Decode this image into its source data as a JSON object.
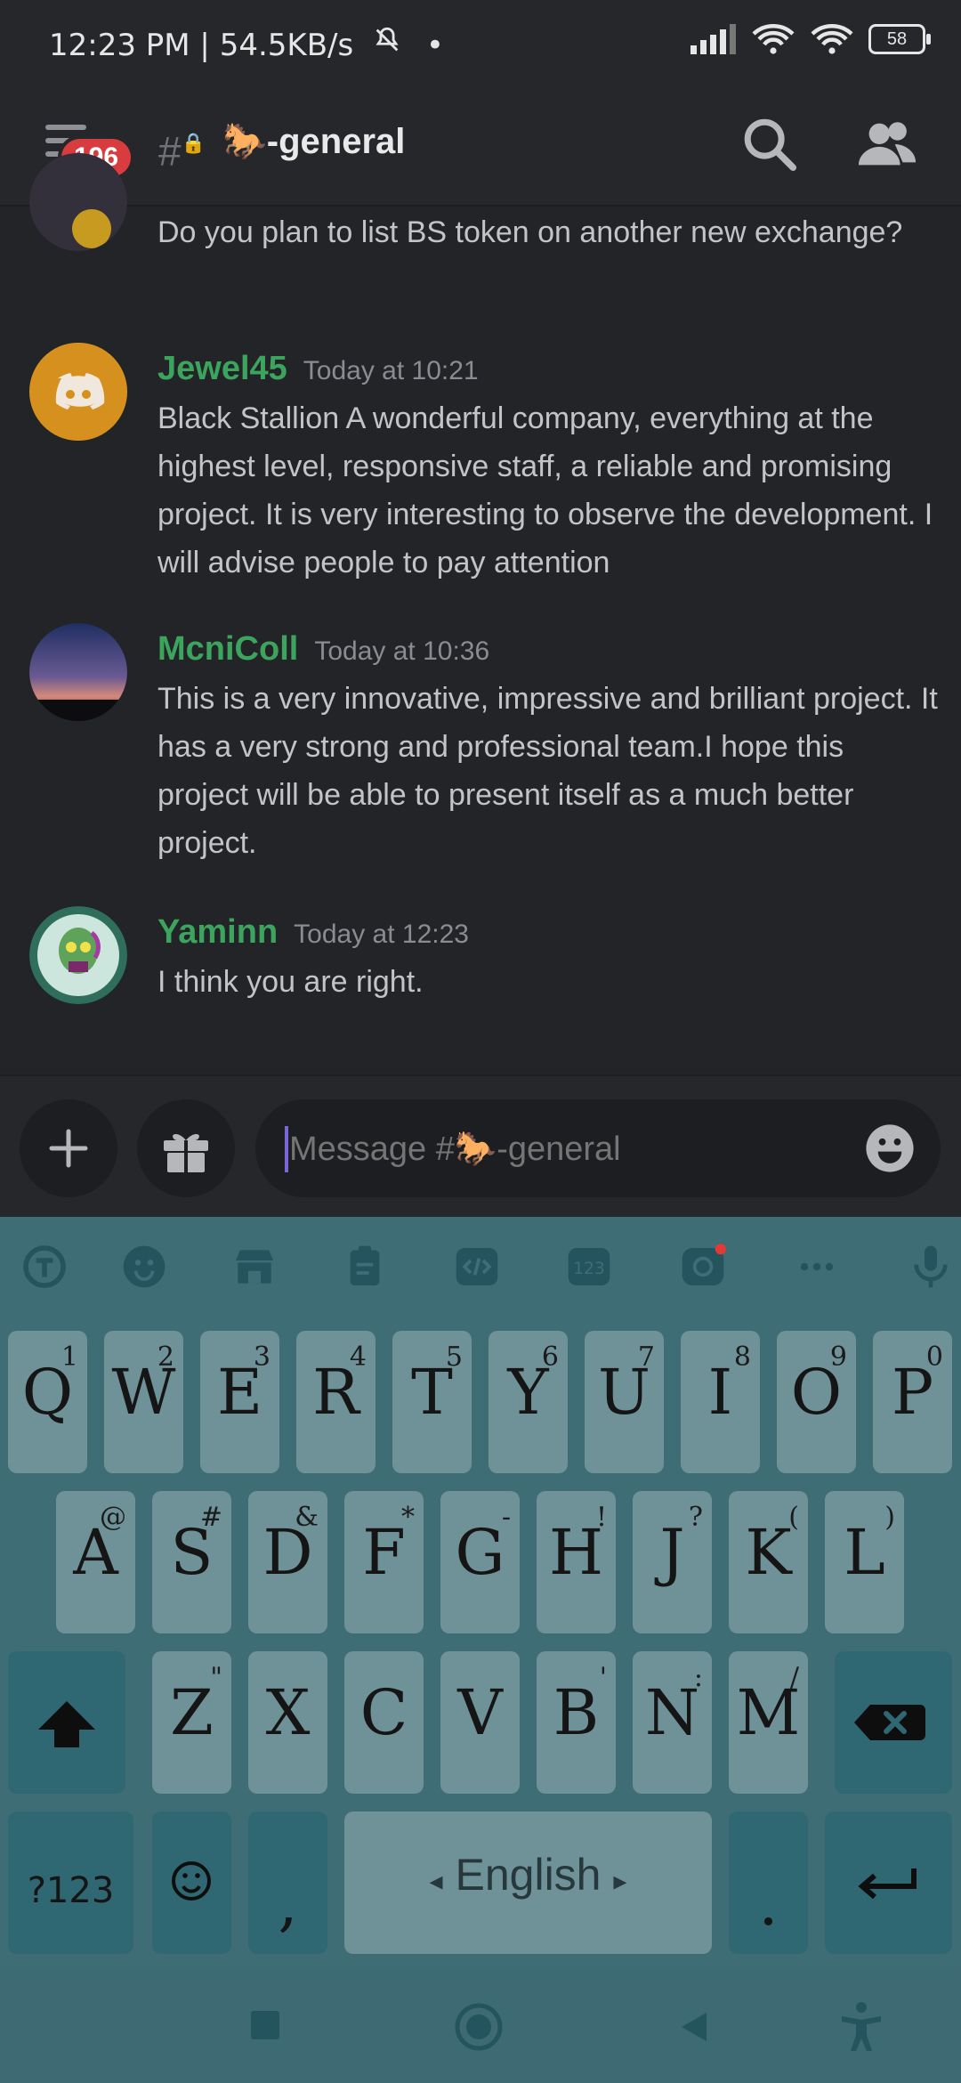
{
  "status_bar": {
    "time_speed": "12:23 PM | 54.5KB/s",
    "dot": "•",
    "battery": "58"
  },
  "header": {
    "unread_badge": "196",
    "channel_name": "🐎-general"
  },
  "messages": [
    {
      "author": "",
      "time": "",
      "text": "Do you plan to list BS token on another new exchange?"
    },
    {
      "author": "Jewel45",
      "time": "Today at 10:21",
      "text": "Black Stallion A wonderful company, everything at the highest level, responsive staff, a reliable and promising project. It is very interesting to observe the development. I will advise people to pay attention"
    },
    {
      "author": "McniColl",
      "time": "Today at 10:36",
      "text": "This is a very innovative, impressive and brilliant project. It has a very strong and professional team.I hope this project will be able to present itself as a much better project."
    },
    {
      "author": "Yaminn",
      "time": "Today at 12:23",
      "text": "I think you are right."
    }
  ],
  "composer": {
    "placeholder": "Message #🐎-general"
  },
  "keyboard": {
    "row1": [
      {
        "k": "Q",
        "h": "1"
      },
      {
        "k": "W",
        "h": "2"
      },
      {
        "k": "E",
        "h": "3"
      },
      {
        "k": "R",
        "h": "4"
      },
      {
        "k": "T",
        "h": "5"
      },
      {
        "k": "Y",
        "h": "6"
      },
      {
        "k": "U",
        "h": "7"
      },
      {
        "k": "I",
        "h": "8"
      },
      {
        "k": "O",
        "h": "9"
      },
      {
        "k": "P",
        "h": "0"
      }
    ],
    "row2": [
      {
        "k": "A",
        "h": "@"
      },
      {
        "k": "S",
        "h": "#"
      },
      {
        "k": "D",
        "h": "&"
      },
      {
        "k": "F",
        "h": "*"
      },
      {
        "k": "G",
        "h": "-"
      },
      {
        "k": "H",
        "h": "!"
      },
      {
        "k": "J",
        "h": "?"
      },
      {
        "k": "K",
        "h": "("
      },
      {
        "k": "L",
        "h": ")"
      }
    ],
    "row3": [
      {
        "k": "Z",
        "h": "\""
      },
      {
        "k": "X",
        "h": ""
      },
      {
        "k": "C",
        "h": ""
      },
      {
        "k": "V",
        "h": ""
      },
      {
        "k": "B",
        "h": "'"
      },
      {
        "k": "N",
        "h": ":"
      },
      {
        "k": "M",
        "h": "/"
      }
    ],
    "sym_label": "?123",
    "comma": ",",
    "space_label": "English",
    "period": "."
  }
}
